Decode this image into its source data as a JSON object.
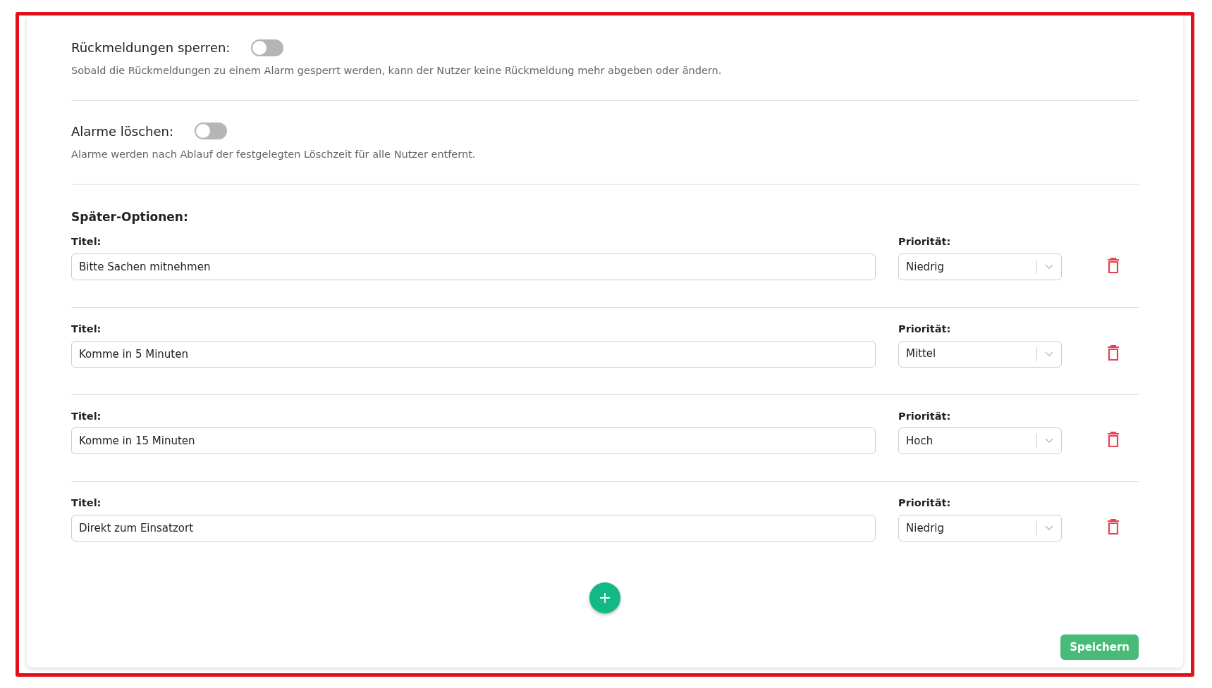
{
  "settings": [
    {
      "label": "Rückmeldungen sperren:",
      "on": false,
      "description": "Sobald die Rückmeldungen zu einem Alarm gesperrt werden, kann der Nutzer keine Rückmeldung mehr abgeben oder ändern."
    },
    {
      "label": "Alarme löschen:",
      "on": false,
      "description": "Alarme werden nach Ablauf der festgelegten Löschzeit für alle Nutzer entfernt."
    }
  ],
  "later_options": {
    "heading": "Später-Optionen:",
    "items": [
      {
        "title_label": "Titel:",
        "title": "Bitte Sachen mitnehmen",
        "priority_label": "Priorität:",
        "priority": "Niedrig"
      },
      {
        "title_label": "Titel:",
        "title": "Komme in 5 Minuten",
        "priority_label": "Priorität:",
        "priority": "Mittel"
      },
      {
        "title_label": "Titel:",
        "title": "Komme in 15 Minuten",
        "priority_label": "Priorität:",
        "priority": "Hoch"
      },
      {
        "title_label": "Titel:",
        "title": "Direkt zum Einsatzort",
        "priority_label": "Priorität:",
        "priority": "Niedrig"
      }
    ]
  },
  "save_button": "Speichern"
}
